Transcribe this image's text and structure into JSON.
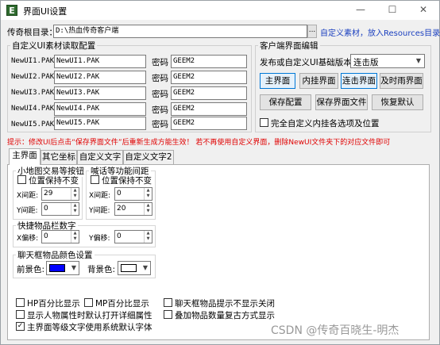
{
  "window": {
    "title": "界面UI设置",
    "icon_letter": "E",
    "minimize": "—",
    "maximize": "☐",
    "close": "✕"
  },
  "root": {
    "label": "传奇根目录：",
    "value": "D:\\热血传奇客户端",
    "browse": "...",
    "link": "自定义素材，放入Resources目录"
  },
  "ui_group": {
    "title": "自定义UI素材读取配置",
    "pwd_label": "密码",
    "rows": [
      {
        "label": "NewUI1.PAK",
        "file": "NewUI1.PAK",
        "password": "GEEM2"
      },
      {
        "label": "NewUI2.PAK",
        "file": "NewUI2.PAK",
        "password": "GEEM2"
      },
      {
        "label": "NewUI3.PAK",
        "file": "NewUI3.PAK",
        "password": "GEEM2"
      },
      {
        "label": "NewUI4.PAK",
        "file": "NewUI4.PAK",
        "password": "GEEM2"
      },
      {
        "label": "NewUI5.PAK",
        "file": "NewUI5.PAK",
        "password": "GEEM2"
      }
    ]
  },
  "client_group": {
    "title": "客户端界面编辑",
    "version_label": "发布或自定义UI基础版本：",
    "version_value": "连击版",
    "buttons": {
      "main": "主界面",
      "inner": "内挂界面",
      "combo": "连击界面",
      "ontime": "及时雨界面",
      "save_cfg": "保存配置",
      "save_ui": "保存界面文件",
      "restore": "恢复默认"
    },
    "full_custom": "完全自定义内挂各选项及位置"
  },
  "hint": "提示：修改UI后点击“保存界面文件”后重新生成方能生效！    若不再使用自定义界面，删除NewUI文件夹下的对应文件即可",
  "tabs": [
    "主界面",
    "其它坐标",
    "自定义文字",
    "自定义文字2"
  ],
  "minimap": {
    "title": "小地图交易等按钮",
    "keep": "位置保持不变",
    "x_label": "X间距:",
    "x_value": "29",
    "y_label": "Y间距:",
    "y_value": "0"
  },
  "shout": {
    "title": "喊话等功能间距",
    "keep": "位置保持不变",
    "x_label": "X间距:",
    "x_value": "0",
    "y_label": "Y间距:",
    "y_value": "20"
  },
  "quickbar": {
    "title": "快捷物品栏数字",
    "x_label": "X偏移:",
    "x_value": "0",
    "y_label": "Y偏移:",
    "y_value": "0"
  },
  "chatcolor": {
    "title": "聊天框物品颜色设置",
    "fg_label": "前景色:",
    "bg_label": "背景色:",
    "fg_color": "#0000ff",
    "bg_color": "#ffffff"
  },
  "checks": {
    "hp_pct": "HP百分比显示",
    "mp_pct": "MP百分比显示",
    "chat_hint": "聊天框物品提示不显示关闭",
    "show_attr": "显示人物属性时默认打开详细属性",
    "stack": "叠加物品数量复古方式显示",
    "sysfont": "主界面等级文字使用系统默认字体"
  },
  "watermark": "CSDN @传奇百晓生-明杰"
}
